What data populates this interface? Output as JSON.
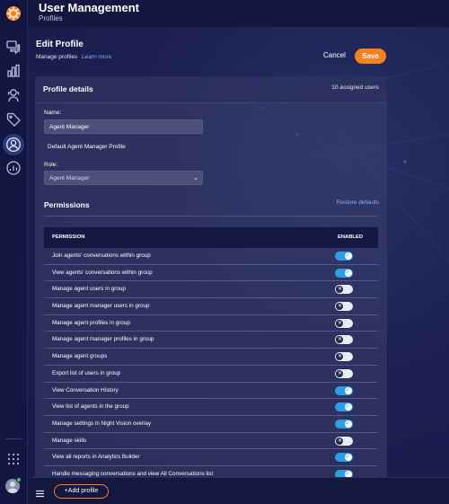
{
  "app": {
    "title": "User Management",
    "subtitle": "Profiles"
  },
  "sidebar": {
    "items": [
      {
        "icon": "chat-icon"
      },
      {
        "icon": "bar-chart-icon"
      },
      {
        "icon": "agent-icon"
      },
      {
        "icon": "tag-icon"
      },
      {
        "icon": "user-circle-icon",
        "active": true
      },
      {
        "icon": "dashboard-icon"
      }
    ],
    "apps_icon": "apps-grid-icon"
  },
  "page": {
    "title": "Edit Profile",
    "subtitle": "Manage profiles",
    "learn_more": "Learn more",
    "cancel_label": "Cancel",
    "save_label": "Save"
  },
  "profile": {
    "section_title": "Profile details",
    "assigned": "10 assigned users",
    "name_label": "Name:",
    "name_value": "Agent Manager",
    "description": "Default Agent Manager Profile",
    "role_label": "Role:",
    "role_value": "Agent Manager"
  },
  "permissions": {
    "title": "Permissions",
    "restore_label": "Restore defaults",
    "col_permission": "PERMISSION",
    "col_enabled": "ENABLED",
    "rows": [
      {
        "label": "Join agents' conversations within group",
        "enabled": true
      },
      {
        "label": "View agents' conversations within group",
        "enabled": true
      },
      {
        "label": "Manage agent users in group",
        "enabled": false
      },
      {
        "label": "Manage agent manager users in group",
        "enabled": false
      },
      {
        "label": "Manage agent profiles in group",
        "enabled": false
      },
      {
        "label": "Manage agent manager profiles in group",
        "enabled": false
      },
      {
        "label": "Manage agent groups",
        "enabled": false
      },
      {
        "label": "Export list of users in group",
        "enabled": false
      },
      {
        "label": "View Conversation History",
        "enabled": true
      },
      {
        "label": "View list of agents in the group",
        "enabled": true
      },
      {
        "label": "Manage settings in Night Vision overlay",
        "enabled": true
      },
      {
        "label": "Manage skills",
        "enabled": false
      },
      {
        "label": "View all reports in Analytics Builder",
        "enabled": true
      },
      {
        "label": "Handle messaging conversations and view All Conversations list",
        "enabled": true
      }
    ]
  },
  "bottom": {
    "add_profile_label": "+Add profile"
  },
  "colors": {
    "accent": "#f5821f",
    "toggle_on": "#2e9de6",
    "link": "#7fb1ff"
  }
}
